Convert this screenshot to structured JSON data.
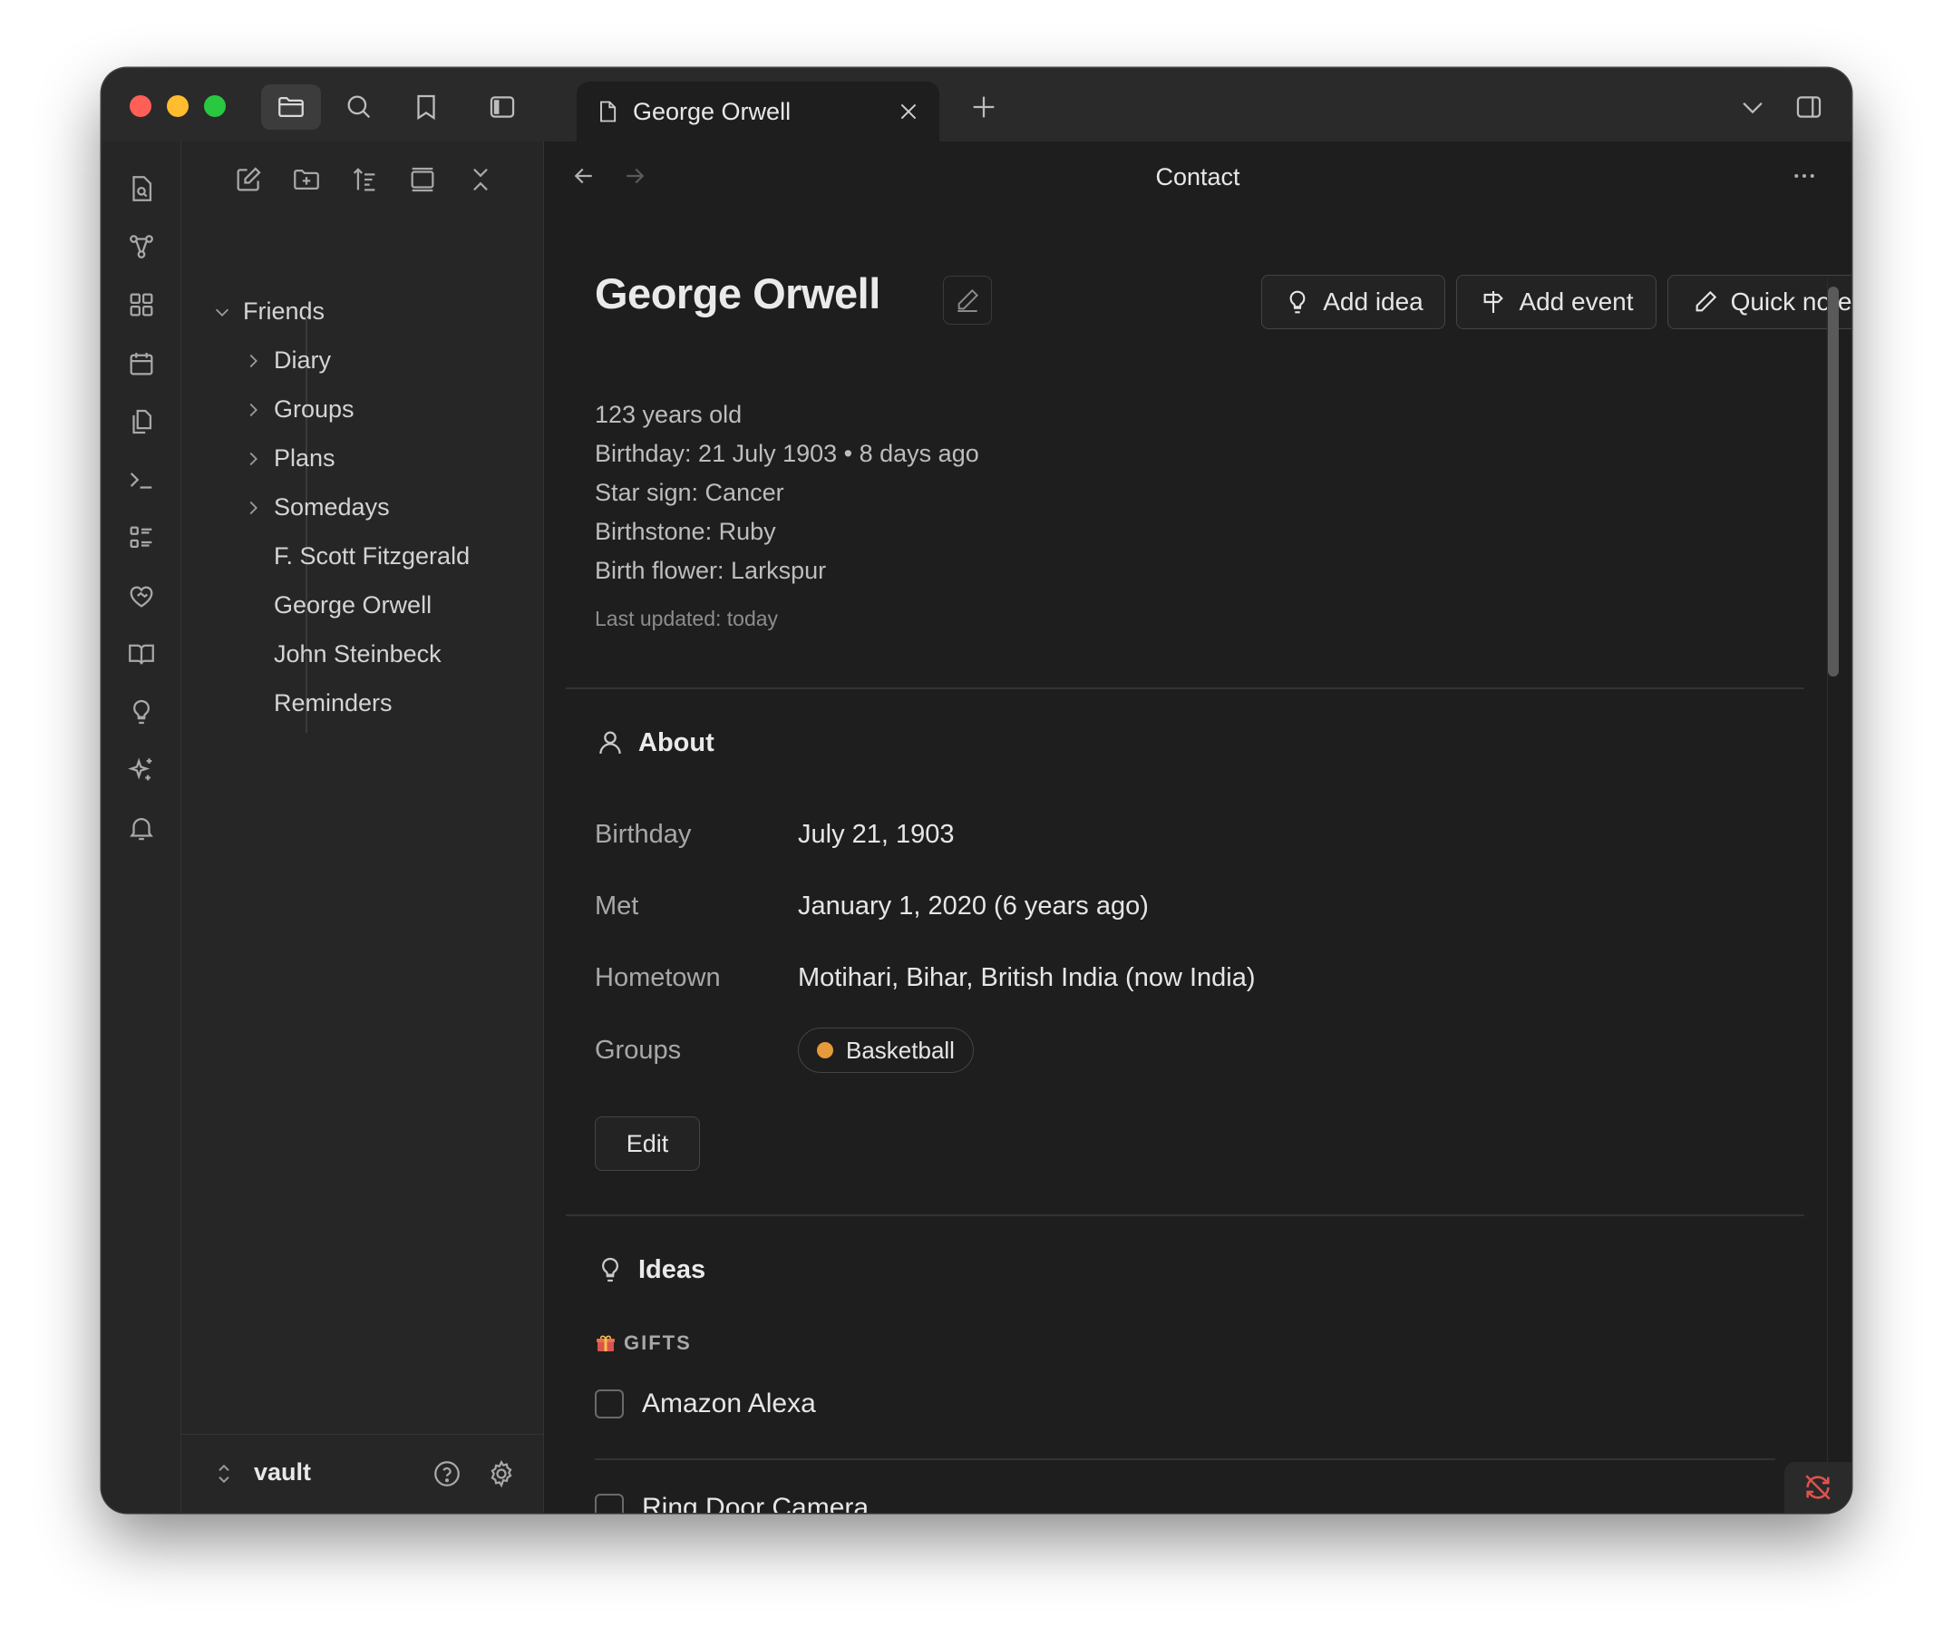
{
  "tab": {
    "title": "George Orwell"
  },
  "sidebar": {
    "tree": {
      "root": "Friends",
      "folders": [
        "Diary",
        "Groups",
        "Plans",
        "Somedays"
      ],
      "files": [
        "F. Scott Fitzgerald",
        "George Orwell",
        "John Steinbeck",
        "Reminders"
      ]
    },
    "vault_name": "vault"
  },
  "view": {
    "title": "Contact"
  },
  "contact": {
    "name": "George Orwell",
    "age": "123 years old",
    "birthday_line": "Birthday: 21 July 1903 • 8 days ago",
    "star_sign": "Star sign: Cancer",
    "birthstone": "Birthstone: Ruby",
    "birth_flower": "Birth flower: Larkspur",
    "last_updated": "Last updated: today"
  },
  "actions": {
    "add_idea": "Add idea",
    "add_event": "Add event",
    "quick_note": "Quick note"
  },
  "about": {
    "heading": "About",
    "rows": [
      {
        "label": "Birthday",
        "value": "July 21, 1903"
      },
      {
        "label": "Met",
        "value": "January 1, 2020 (6 years ago)"
      },
      {
        "label": "Hometown",
        "value": "Motihari, Bihar, British India (now India)"
      },
      {
        "label": "Groups",
        "value": ""
      }
    ],
    "group_pill": "Basketball",
    "edit_label": "Edit"
  },
  "ideas": {
    "heading": "Ideas",
    "category": "GIFTS",
    "items": [
      "Amazon Alexa",
      "Ring Door Camera"
    ]
  },
  "colors": {
    "accent_dot": "#e69a3b",
    "close": "#ff5f57",
    "minimize": "#febc2e",
    "zoom": "#28c840"
  }
}
